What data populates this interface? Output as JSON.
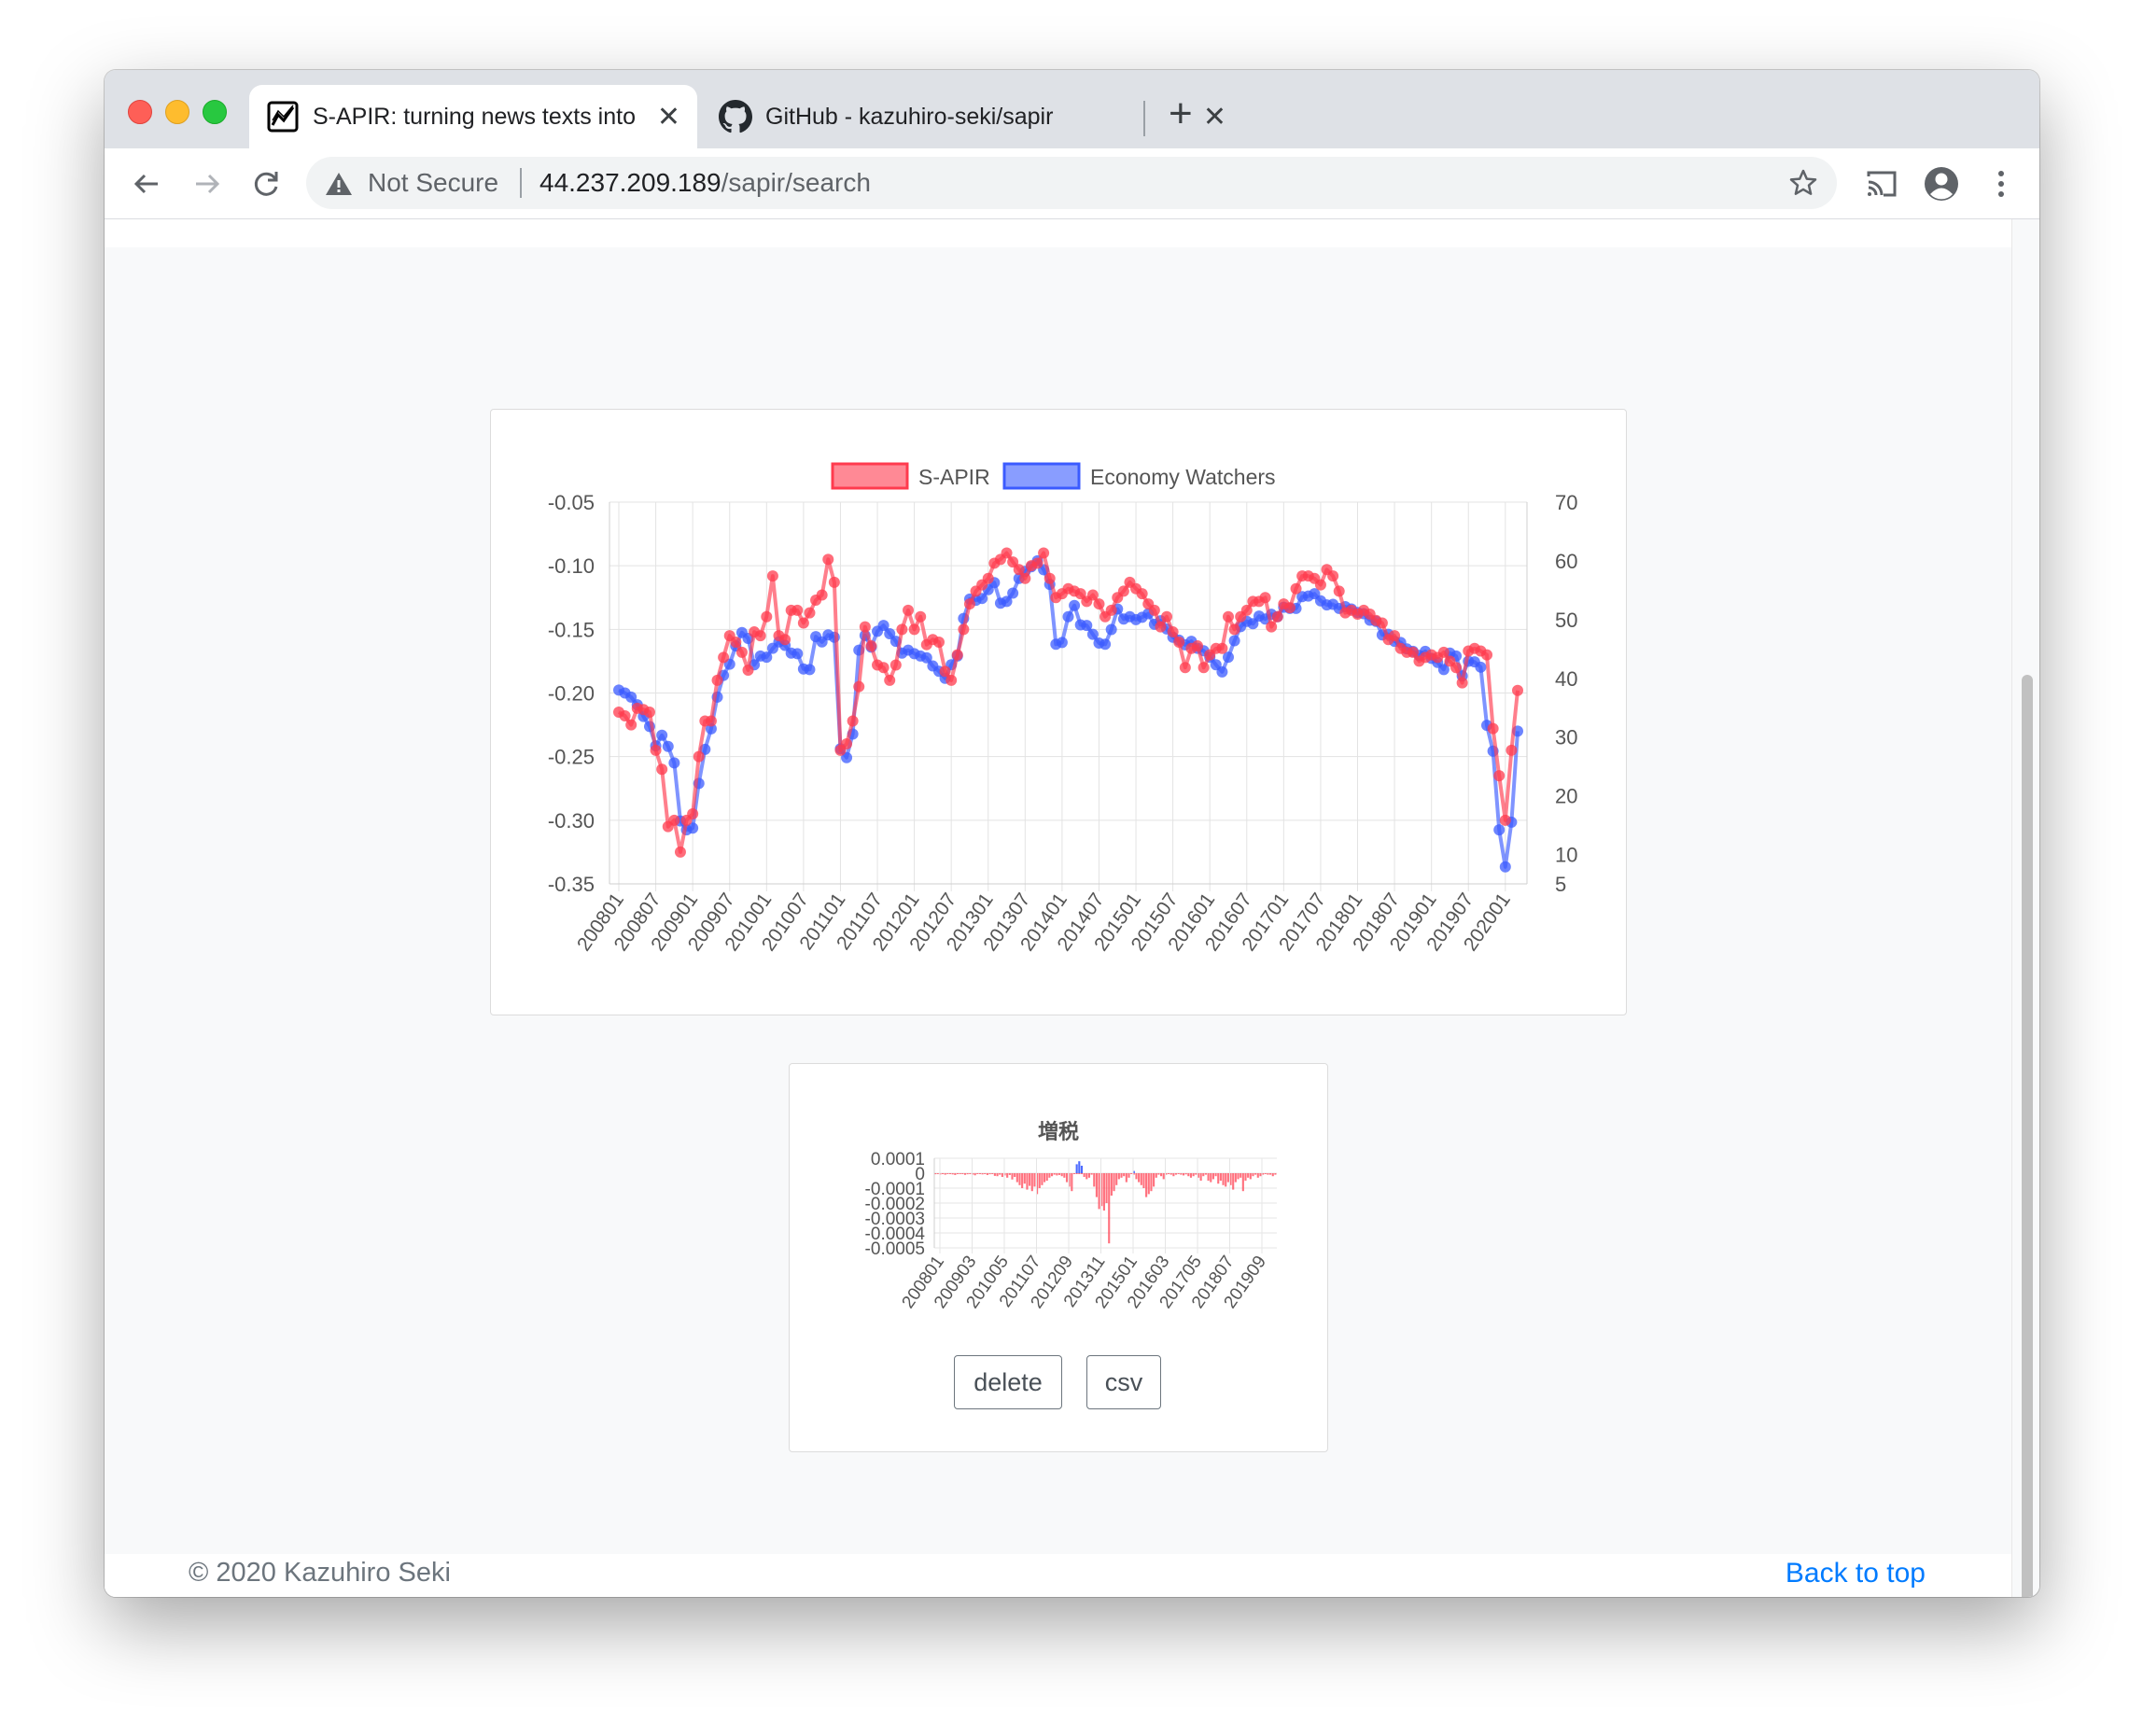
{
  "browser": {
    "tabs": [
      {
        "title": "S-APIR: turning news texts into",
        "icon": "chart-favicon-icon",
        "active": true
      },
      {
        "title": "GitHub - kazuhiro-seki/sapir",
        "icon": "github-icon",
        "active": false
      }
    ],
    "new_tab_label": "+",
    "close_label": "✕",
    "address": {
      "security_label": "Not Secure",
      "host": "44.237.209.189",
      "path": "/sapir/search"
    }
  },
  "chart_data": [
    {
      "type": "line",
      "legend": [
        "S-APIR",
        "Economy Watchers"
      ],
      "legend_position": "top",
      "y_left": {
        "min": -0.35,
        "max": -0.05,
        "ticks": [
          "-0.05",
          "-0.10",
          "-0.15",
          "-0.20",
          "-0.25",
          "-0.30",
          "-0.35"
        ]
      },
      "y_right": {
        "min": 5,
        "max": 70,
        "ticks": [
          "70",
          "60",
          "50",
          "40",
          "30",
          "20",
          "10",
          "5"
        ]
      },
      "x_tick_labels": [
        "200801",
        "200807",
        "200901",
        "200907",
        "201001",
        "201007",
        "201101",
        "201107",
        "201201",
        "201207",
        "201301",
        "201307",
        "201401",
        "201407",
        "201501",
        "201507",
        "201601",
        "201607",
        "201701",
        "201707",
        "201801",
        "201807",
        "201901",
        "201907",
        "202001"
      ],
      "series": [
        {
          "name": "S-APIR",
          "color": "#ff3b4e",
          "axis": "left",
          "values": [
            -0.215,
            -0.218,
            -0.225,
            -0.212,
            -0.213,
            -0.215,
            -0.245,
            -0.26,
            -0.305,
            -0.3,
            -0.325,
            -0.3,
            -0.295,
            -0.25,
            -0.222,
            -0.222,
            -0.19,
            -0.172,
            -0.155,
            -0.16,
            -0.168,
            -0.182,
            -0.152,
            -0.155,
            -0.14,
            -0.108,
            -0.155,
            -0.158,
            -0.135,
            -0.135,
            -0.145,
            -0.137,
            -0.127,
            -0.123,
            -0.095,
            -0.113,
            -0.245,
            -0.24,
            -0.222,
            -0.195,
            -0.148,
            -0.163,
            -0.178,
            -0.18,
            -0.19,
            -0.178,
            -0.15,
            -0.135,
            -0.15,
            -0.14,
            -0.162,
            -0.158,
            -0.16,
            -0.183,
            -0.19,
            -0.17,
            -0.15,
            -0.13,
            -0.12,
            -0.115,
            -0.11,
            -0.098,
            -0.095,
            -0.09,
            -0.097,
            -0.103,
            -0.11,
            -0.1,
            -0.098,
            -0.09,
            -0.11,
            -0.125,
            -0.122,
            -0.118,
            -0.12,
            -0.122,
            -0.128,
            -0.123,
            -0.13,
            -0.14,
            -0.135,
            -0.125,
            -0.12,
            -0.113,
            -0.118,
            -0.122,
            -0.13,
            -0.135,
            -0.148,
            -0.14,
            -0.152,
            -0.16,
            -0.18,
            -0.165,
            -0.163,
            -0.18,
            -0.17,
            -0.165,
            -0.165,
            -0.14,
            -0.15,
            -0.14,
            -0.135,
            -0.128,
            -0.128,
            -0.125,
            -0.148,
            -0.14,
            -0.13,
            -0.133,
            -0.118,
            -0.108,
            -0.108,
            -0.11,
            -0.115,
            -0.103,
            -0.108,
            -0.12,
            -0.137,
            -0.135,
            -0.138,
            -0.135,
            -0.138,
            -0.143,
            -0.145,
            -0.158,
            -0.155,
            -0.165,
            -0.168,
            -0.168,
            -0.175,
            -0.172,
            -0.17,
            -0.172,
            -0.168,
            -0.175,
            -0.18,
            -0.192,
            -0.167,
            -0.165,
            -0.167,
            -0.17,
            -0.228,
            -0.265,
            -0.3,
            -0.245,
            -0.198
          ]
        },
        {
          "name": "Economy Watchers",
          "color": "#3b5bff",
          "axis": "right",
          "values": [
            38,
            37.5,
            36.8,
            35.5,
            33.5,
            31.8,
            28.5,
            30.3,
            28.4,
            25.6,
            15.7,
            14.2,
            14.5,
            22.1,
            27.9,
            31.4,
            36.8,
            40.5,
            42.4,
            45.5,
            47.8,
            46.8,
            42.3,
            43.8,
            43.6,
            45.1,
            46.2,
            45.6,
            44.3,
            44.2,
            41.6,
            41.5,
            47.1,
            46.2,
            47.4,
            47.0,
            28.0,
            26.5,
            30.5,
            44.8,
            47.3,
            45.3,
            48.0,
            49.0,
            47.6,
            46.3,
            44.3,
            44.8,
            44.2,
            43.8,
            43.5,
            42.1,
            41.2,
            40.0,
            42.3,
            43.8,
            50.2,
            53.5,
            53.3,
            53.6,
            55.1,
            56.3,
            52.8,
            53.1,
            54.5,
            57.0,
            58.2,
            59.0,
            60.0,
            58.5,
            56.0,
            45.8,
            46.1,
            50.5,
            52.4,
            49.1,
            49.0,
            47.5,
            46.0,
            45.8,
            48.3,
            51.8,
            50.1,
            50.5,
            50.0,
            50.4,
            51.0,
            49.2,
            49.8,
            48.4,
            47.0,
            46.5,
            45.7,
            46.3,
            45.1,
            44.7,
            43.6,
            42.3,
            41.1,
            43.6,
            46.4,
            48.8,
            49.7,
            49.3,
            50.6,
            50.1,
            50.9,
            50.5,
            52.1,
            51.9,
            51.9,
            53.9,
            54.0,
            54.4,
            53.2,
            52.5,
            52.6,
            51.9,
            52.2,
            51.8,
            51.2,
            51.0,
            49.9,
            49.7,
            47.4,
            47.5,
            46.3,
            46.1,
            45.0,
            44.6,
            43.9,
            44.6,
            43.4,
            42.7,
            41.5,
            44.3,
            43.8,
            40.4,
            42.9,
            42.8,
            41.9,
            32.0,
            27.6,
            14.2,
            7.9,
            15.5,
            31.0
          ]
        }
      ]
    },
    {
      "type": "bar",
      "title": "増税",
      "y_ticks": [
        "0.0001",
        "0",
        "-0.0001",
        "-0.0002",
        "-0.0003",
        "-0.0004",
        "-0.0005"
      ],
      "ylim": [
        -0.0005,
        0.0001
      ],
      "x_tick_labels": [
        "200801",
        "200903",
        "201005",
        "201107",
        "201209",
        "201311",
        "201501",
        "201603",
        "201705",
        "201807",
        "201909"
      ],
      "series": [
        {
          "name": "",
          "color": "#ff4d5e",
          "values": [
            -7e-06,
            -5e-06,
            -9e-06,
            -5e-06,
            -1e-05,
            -6e-06,
            -4e-06,
            -8e-06,
            -1.2e-05,
            -6e-06,
            -3e-06,
            -5e-06,
            -1.1e-05,
            -7e-06,
            -4e-06,
            -9e-06,
            -1.4e-05,
            -6e-06,
            -5e-06,
            -8e-06,
            -4e-06,
            -1.2e-05,
            -7e-06,
            -3e-06,
            -1.8e-05,
            -2e-05,
            -1e-05,
            -2.5e-05,
            -1.5e-05,
            -3e-05,
            -1.2e-05,
            -4.2e-05,
            -2.5e-05,
            -6e-05,
            -8e-05,
            -0.0001,
            -7e-05,
            -0.00011,
            -8.5e-05,
            -0.00012,
            -9e-05,
            -0.00014,
            -0.0001,
            -8e-05,
            -6e-05,
            -5e-05,
            -3e-05,
            -2e-05,
            -1e-05,
            -1.5e-05,
            -1.2e-05,
            -2e-05,
            -3e-05,
            -6e-05,
            -9e-05,
            -0.00012,
            0.0,
            0.0,
            0.0,
            0.0,
            -2.5e-05,
            -4e-05,
            -3e-05,
            -1e-05,
            -9e-05,
            -0.00016,
            -0.00024,
            -0.00022,
            -0.00025,
            -0.0002,
            -0.00047,
            -0.00015,
            -0.00012,
            -8e-05,
            -4e-05,
            -3e-05,
            -2e-05,
            -6e-05,
            -3e-05,
            0.0,
            -1e-05,
            -4e-05,
            -6e-05,
            -8e-05,
            -0.0001,
            -0.00016,
            -0.00014,
            -0.00012,
            -9e-05,
            -3e-05,
            -1e-05,
            -2e-05,
            -4e-05,
            -1e-05,
            -5e-06,
            -1e-05,
            -2e-05,
            -1e-05,
            -5e-06,
            -1e-05,
            -1.5e-05,
            -8e-06,
            -2e-05,
            -3e-05,
            -2e-05,
            -1e-05,
            -3e-05,
            -5e-05,
            -2e-05,
            -1e-05,
            -5e-05,
            -6e-05,
            -4e-05,
            -2e-05,
            -7e-05,
            -5e-05,
            -8e-05,
            -9e-05,
            -6e-05,
            -8e-05,
            -0.00011,
            -6e-05,
            -4e-05,
            -3e-05,
            -0.00012,
            -5e-05,
            -3e-05,
            -4e-05,
            -2e-05,
            -1e-05,
            -3e-05,
            -2e-05,
            -1e-05,
            -5e-06,
            -1e-05,
            -1e-05,
            -2e-05,
            -1e-05
          ]
        },
        {
          "name": "",
          "color": "#4d6bff",
          "values_at": {
            "57": 6e-05,
            "58": 8e-05,
            "59": 5e-05,
            "80": 1.5e-05
          }
        }
      ]
    }
  ],
  "buttons": {
    "delete": "delete",
    "csv": "csv"
  },
  "footer": {
    "copyright": "© 2020 Kazuhiro Seki",
    "back_to_top": "Back to top"
  }
}
